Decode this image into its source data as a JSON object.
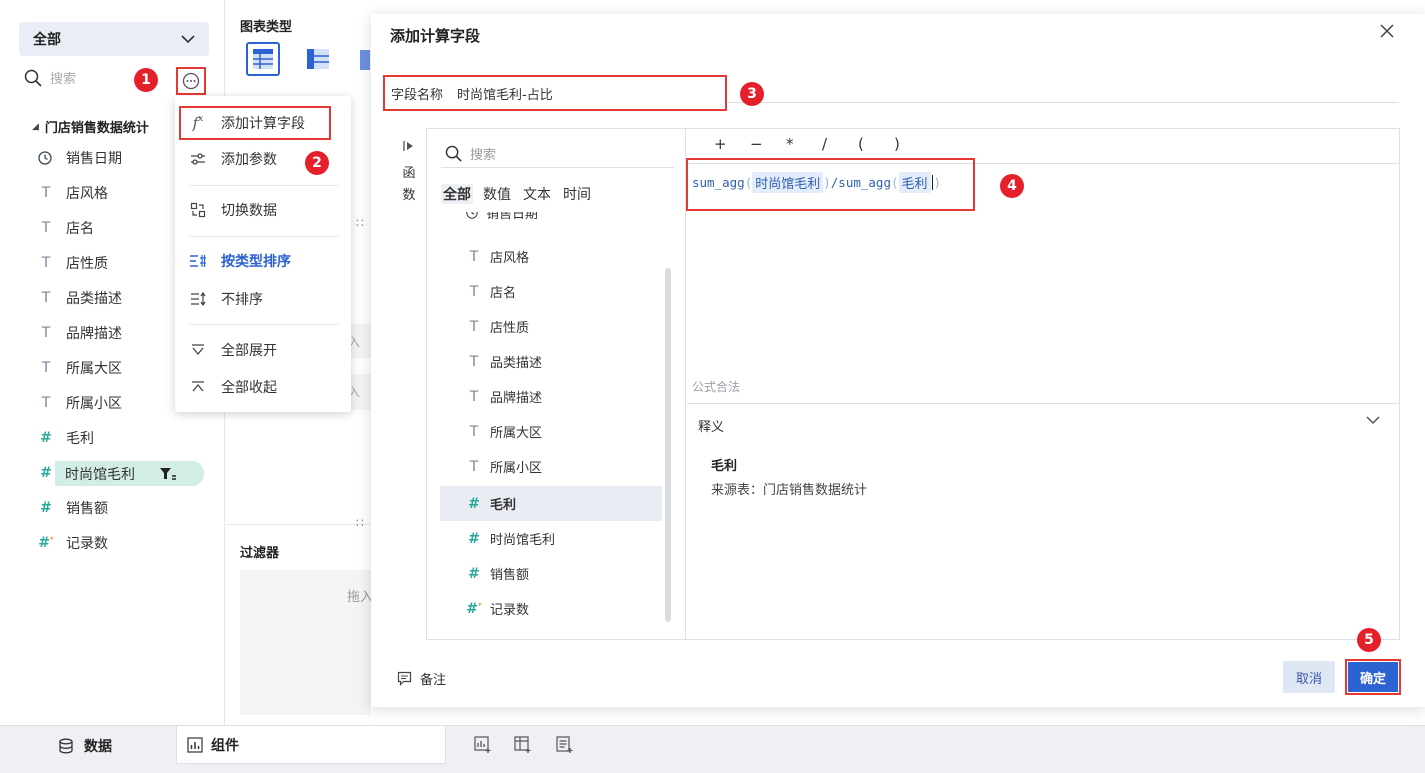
{
  "left": {
    "scope_select": "全部",
    "search_placeholder": "搜索",
    "dataset_title": "门店销售数据统计",
    "fields": [
      {
        "icon": "clock-icon",
        "label": "销售日期"
      },
      {
        "icon": "text-type-icon",
        "label": "店风格"
      },
      {
        "icon": "text-type-icon",
        "label": "店名"
      },
      {
        "icon": "text-type-icon",
        "label": "店性质"
      },
      {
        "icon": "text-type-icon",
        "label": "品类描述"
      },
      {
        "icon": "text-type-icon",
        "label": "品牌描述"
      },
      {
        "icon": "text-type-icon",
        "label": "所属大区"
      },
      {
        "icon": "text-type-icon",
        "label": "所属小区"
      },
      {
        "icon": "number-type-icon",
        "label": "毛利"
      },
      {
        "icon": "number-type-icon",
        "label": "时尚馆毛利"
      },
      {
        "icon": "count-type-icon",
        "label": "记录数"
      }
    ],
    "sales_label": "销售额"
  },
  "badges": [
    "1",
    "2",
    "3",
    "4",
    "5"
  ],
  "dropdown": {
    "add_calc_field": "添加计算字段",
    "add_param": "添加参数",
    "switch_data": "切换数据",
    "sort_by_type": "按类型排序",
    "no_sort": "不排序",
    "expand_all": "全部展开",
    "collapse_all": "全部收起"
  },
  "chart_panel": {
    "chart_type_label": "图表类型",
    "filter_label": "过滤器",
    "drag_hint": "拖入",
    "input_hint_1": "入",
    "input_hint_2": "入"
  },
  "dialog": {
    "title": "添加计算字段",
    "field_name_label": "字段名称",
    "field_name_value": "时尚馆毛利-占比",
    "fn_tab_char1": "函",
    "fn_tab_char2": "数",
    "search_placeholder": "搜索",
    "filter_tabs": [
      "全部",
      "数值",
      "文本",
      "时间"
    ],
    "partial_item": "销售日期",
    "list_items": [
      {
        "type": "T",
        "label": "店风格"
      },
      {
        "type": "T",
        "label": "店名"
      },
      {
        "type": "T",
        "label": "店性质"
      },
      {
        "type": "T",
        "label": "品类描述"
      },
      {
        "type": "T",
        "label": "品牌描述"
      },
      {
        "type": "T",
        "label": "所属大区"
      },
      {
        "type": "T",
        "label": "所属小区"
      },
      {
        "type": "#",
        "label": "毛利"
      },
      {
        "type": "#",
        "label": "时尚馆毛利"
      },
      {
        "type": "#",
        "label": "销售额"
      },
      {
        "type": "#*",
        "label": "记录数"
      }
    ],
    "operators": [
      "+",
      "−",
      "*",
      "/",
      "(",
      ")"
    ],
    "formula": {
      "fn1": "sum_agg",
      "arg1": "时尚馆毛利",
      "slash": "/",
      "fn2": "sum_agg",
      "arg2": "毛利",
      "lpar": "(",
      "rpar": ")"
    },
    "validity": "公式合法",
    "explain_label": "释义",
    "explain_name": "毛利",
    "explain_source": "来源表：门店销售数据统计",
    "note_label": "备注",
    "cancel": "取消",
    "confirm": "确定"
  },
  "bottom": {
    "tab_data": "数据",
    "tab_component": "组件"
  },
  "colors": {
    "accent": "#2d62d3",
    "annotation_red": "#e53935",
    "number_field": "#2aa99a"
  }
}
